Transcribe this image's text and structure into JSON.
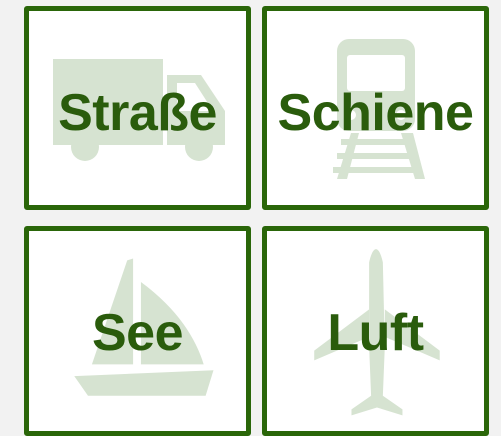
{
  "tiles": [
    {
      "id": "road",
      "label": "Straße",
      "icon": "truck-icon"
    },
    {
      "id": "rail",
      "label": "Schiene",
      "icon": "train-icon"
    },
    {
      "id": "sea",
      "label": "See",
      "icon": "sailboat-icon"
    },
    {
      "id": "air",
      "label": "Luft",
      "icon": "airplane-icon"
    }
  ],
  "colors": {
    "accent": "#2a6609",
    "label": "#2a5c0c",
    "icon": "#d6e3d1",
    "background": "#f2f2f2"
  }
}
